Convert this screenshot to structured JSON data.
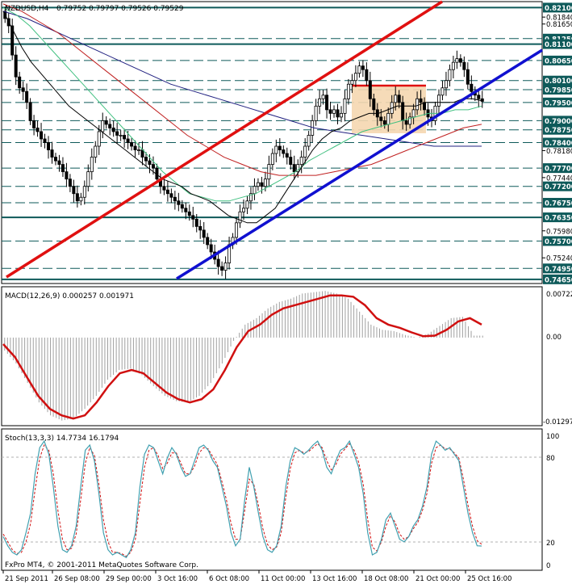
{
  "header": {
    "symbol": "NZDUSD,H4",
    "ohlc": "0.79752 0.79797 0.79526 0.79529"
  },
  "copyright": "FxPro MT4, © 2001-2011 MetaQuotes Software Corp.",
  "colors": {
    "channel_upper": "#e01010",
    "channel_lower": "#1010d0",
    "level_solid": "#0e5a5a",
    "level_dash": "#0e5a5a",
    "price_tag": "#0e5a5a",
    "candle": "#000000",
    "ma_fast": "#000000",
    "ma_green": "#40c080",
    "ma_red": "#c02020",
    "ma_blue": "#202080",
    "macd_signal": "#d01010",
    "macd_hist": "#a0a0a0",
    "stoch_main": "#40a0b0",
    "stoch_signal": "#d01010",
    "box_fill": "#f5d7b0"
  },
  "chart_data": [
    {
      "type": "line",
      "name": "price",
      "x_labels": [
        "21 Sep 2011",
        "26 Sep 08:00",
        "29 Sep 00:00",
        "3 Oct 16:00",
        "6 Oct 08:00",
        "11 Oct 00:00",
        "13 Oct 16:00",
        "18 Oct 08:00",
        "21 Oct 00:00",
        "25 Oct 16:00"
      ],
      "price_levels": [
        "0.82100",
        "0.81840",
        "0.81650",
        "0.81250",
        "0.81100",
        "0.80650",
        "0.80100",
        "0.79850",
        "0.79500",
        "0.79000",
        "0.78750",
        "0.78400",
        "0.78180",
        "0.77700",
        "0.77440",
        "0.77200",
        "0.76750",
        "0.76350",
        "0.75980",
        "0.75700",
        "0.75240",
        "0.74950",
        "0.74650"
      ],
      "highlighted_levels": [
        "0.82100",
        "0.81250",
        "0.81100",
        "0.80650",
        "0.80100",
        "0.79850",
        "0.79500",
        "0.79000",
        "0.78750",
        "0.78400",
        "0.77700",
        "0.77200",
        "0.76750",
        "0.76350",
        "0.75700",
        "0.74950",
        "0.74650"
      ],
      "current_price": 0.79529,
      "ylim": [
        0.7458,
        0.8222
      ],
      "close": [
        0.818,
        0.816,
        0.808,
        0.802,
        0.799,
        0.798,
        0.795,
        0.79,
        0.788,
        0.787,
        0.785,
        0.784,
        0.782,
        0.78,
        0.779,
        0.778,
        0.776,
        0.774,
        0.772,
        0.77,
        0.768,
        0.769,
        0.772,
        0.776,
        0.78,
        0.783,
        0.787,
        0.79,
        0.789,
        0.788,
        0.787,
        0.786,
        0.786,
        0.785,
        0.784,
        0.783,
        0.782,
        0.782,
        0.78,
        0.779,
        0.778,
        0.777,
        0.774,
        0.772,
        0.771,
        0.77,
        0.769,
        0.768,
        0.767,
        0.766,
        0.765,
        0.764,
        0.763,
        0.761,
        0.76,
        0.758,
        0.756,
        0.754,
        0.752,
        0.75,
        0.749,
        0.751,
        0.756,
        0.758,
        0.762,
        0.765,
        0.766,
        0.768,
        0.77,
        0.772,
        0.773,
        0.772,
        0.774,
        0.778,
        0.781,
        0.783,
        0.782,
        0.781,
        0.78,
        0.778,
        0.776,
        0.778,
        0.78,
        0.783,
        0.786,
        0.79,
        0.794,
        0.796,
        0.797,
        0.793,
        0.792,
        0.793,
        0.791,
        0.792,
        0.796,
        0.8,
        0.801,
        0.803,
        0.805,
        0.804,
        0.801,
        0.796,
        0.793,
        0.791,
        0.79,
        0.789,
        0.792,
        0.795,
        0.797,
        0.795,
        0.79,
        0.789,
        0.791,
        0.793,
        0.796,
        0.795,
        0.793,
        0.791,
        0.79,
        0.794,
        0.797,
        0.799,
        0.801,
        0.804,
        0.806,
        0.807,
        0.806,
        0.804,
        0.8,
        0.798,
        0.797,
        0.796,
        0.7953
      ],
      "ma_fast": [
        0.82,
        0.815,
        0.81,
        0.806,
        0.803,
        0.8,
        0.797,
        0.794,
        0.792,
        0.79,
        0.788,
        0.786,
        0.784,
        0.782,
        0.78,
        0.778,
        0.776,
        0.774,
        0.773,
        0.772,
        0.77,
        0.769,
        0.768,
        0.766,
        0.764,
        0.763,
        0.762,
        0.762,
        0.764,
        0.766,
        0.77,
        0.774,
        0.778,
        0.782,
        0.785,
        0.787,
        0.788,
        0.79,
        0.791,
        0.792,
        0.792,
        0.793,
        0.794,
        0.794,
        0.794,
        0.795,
        0.795,
        0.795,
        0.795,
        0.796,
        0.796,
        0.7955
      ],
      "ma_green": [
        0.821,
        0.819,
        0.816,
        0.812,
        0.808,
        0.804,
        0.8,
        0.796,
        0.792,
        0.788,
        0.784,
        0.78,
        0.776,
        0.773,
        0.77,
        0.769,
        0.768,
        0.768,
        0.769,
        0.77,
        0.772,
        0.774,
        0.776,
        0.779,
        0.781,
        0.783,
        0.785,
        0.787,
        0.788,
        0.789,
        0.79,
        0.791,
        0.792,
        0.792,
        0.793,
        0.793,
        0.794
      ],
      "ma_red": [
        0.822,
        0.82,
        0.817,
        0.814,
        0.81,
        0.806,
        0.802,
        0.798,
        0.794,
        0.79,
        0.786,
        0.783,
        0.78,
        0.778,
        0.776,
        0.775,
        0.775,
        0.775,
        0.776,
        0.777,
        0.778,
        0.78,
        0.782,
        0.784,
        0.786,
        0.788,
        0.789
      ],
      "ma_blue": [
        0.82,
        0.818,
        0.815,
        0.812,
        0.809,
        0.806,
        0.803,
        0.8,
        0.798,
        0.796,
        0.794,
        0.792,
        0.79,
        0.788,
        0.787,
        0.786,
        0.785,
        0.784,
        0.783,
        0.783,
        0.783
      ]
    },
    {
      "type": "line",
      "name": "MACD",
      "label": "MACD(12,26,9) 0.000257 0.001971",
      "y_labels": [
        "0.00722",
        "0.00",
        "-0.01297"
      ],
      "signal": [
        -0.001,
        -0.003,
        -0.006,
        -0.009,
        -0.011,
        -0.012,
        -0.0125,
        -0.012,
        -0.01,
        -0.0075,
        -0.0055,
        -0.005,
        -0.0055,
        -0.007,
        -0.0085,
        -0.0095,
        -0.01,
        -0.0095,
        -0.008,
        -0.005,
        -0.0015,
        0.001,
        0.002,
        0.0035,
        0.0045,
        0.005,
        0.0055,
        0.006,
        0.0065,
        0.0065,
        0.0063,
        0.005,
        0.003,
        0.002,
        0.0015,
        0.0008,
        0.0002,
        0.0003,
        0.0012,
        0.0025,
        0.003,
        0.002
      ],
      "hist": [
        -0.002,
        -0.004,
        -0.007,
        -0.01,
        -0.012,
        -0.0128,
        -0.0125,
        -0.011,
        -0.009,
        -0.0065,
        -0.005,
        -0.0048,
        -0.0058,
        -0.0075,
        -0.009,
        -0.0098,
        -0.01,
        -0.009,
        -0.007,
        -0.004,
        -0.0005,
        0.002,
        0.003,
        0.0045,
        0.0055,
        0.006,
        0.0068,
        0.007,
        0.0072,
        0.0068,
        0.006,
        0.004,
        0.002,
        0.0012,
        0.001,
        0.0004,
        0.0,
        0.0006,
        0.0018,
        0.003,
        0.0032,
        0.0003
      ]
    },
    {
      "type": "line",
      "name": "Stochastic",
      "label": "Stoch(13,3,3) 14.7734 16.1794",
      "y_labels": [
        "100",
        "80",
        "20",
        "0"
      ],
      "main": [
        22,
        15,
        10,
        8,
        12,
        25,
        40,
        70,
        90,
        95,
        85,
        60,
        30,
        12,
        10,
        15,
        30,
        60,
        88,
        92,
        80,
        55,
        25,
        12,
        8,
        10,
        8,
        6,
        12,
        25,
        60,
        85,
        92,
        90,
        80,
        70,
        82,
        90,
        85,
        75,
        68,
        70,
        80,
        90,
        92,
        88,
        80,
        75,
        60,
        45,
        25,
        15,
        20,
        50,
        75,
        60,
        40,
        22,
        12,
        10,
        15,
        30,
        60,
        80,
        90,
        88,
        85,
        88,
        92,
        95,
        88,
        75,
        70,
        80,
        88,
        90,
        95,
        85,
        75,
        55,
        25,
        8,
        10,
        20,
        35,
        40,
        30,
        20,
        18,
        22,
        30,
        35,
        45,
        60,
        85,
        95,
        92,
        88,
        90,
        85,
        80,
        60,
        40,
        25,
        15,
        14.8
      ],
      "signal": [
        24,
        18,
        12,
        9,
        10,
        18,
        32,
        58,
        82,
        92,
        88,
        70,
        42,
        20,
        12,
        13,
        24,
        50,
        78,
        90,
        84,
        62,
        35,
        18,
        10,
        10,
        9,
        7,
        10,
        20,
        48,
        75,
        88,
        90,
        84,
        74,
        78,
        86,
        86,
        78,
        70,
        70,
        76,
        86,
        90,
        89,
        83,
        77,
        64,
        50,
        32,
        20,
        20,
        42,
        66,
        62,
        46,
        28,
        16,
        12,
        14,
        25,
        52,
        74,
        86,
        88,
        86,
        87,
        90,
        93,
        90,
        80,
        73,
        77,
        85,
        89,
        93,
        88,
        79,
        62,
        35,
        14,
        11,
        18,
        30,
        38,
        33,
        24,
        20,
        22,
        28,
        33,
        42,
        55,
        78,
        90,
        92,
        89,
        89,
        86,
        82,
        66,
        46,
        30,
        19,
        16.2
      ]
    }
  ]
}
